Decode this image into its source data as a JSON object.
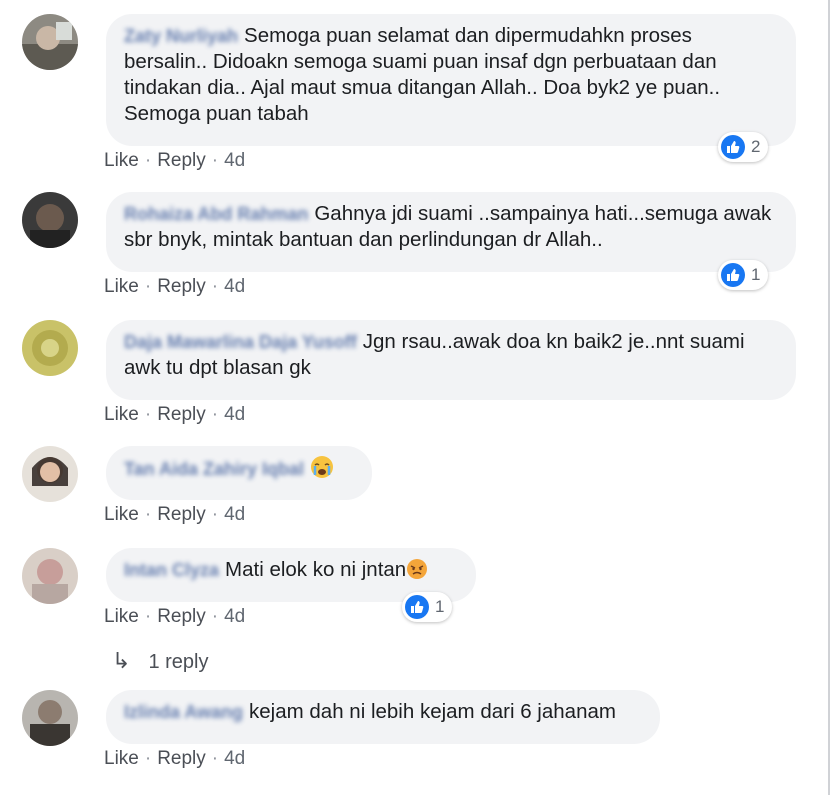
{
  "comments": [
    {
      "author": "Zaty Nurliyah",
      "text": "Semoga puan selamat dan dipermudahkn proses bersalin.. Didoakn semoga suami puan insaf dgn perbuataan dan tindakan dia.. Ajal maut smua ditangan Allah.. Doa byk2 ye puan.. Semoga puan tabah",
      "like": "Like",
      "reply": "Reply",
      "time": "4d",
      "reactions": "2"
    },
    {
      "author": "Rohaiza Abd Rahman",
      "text": "Gahnya jdi suami ..sampainya hati...semuga awak sbr bnyk, mintak bantuan dan perlindungan dr Allah..",
      "like": "Like",
      "reply": "Reply",
      "time": "4d",
      "reactions": "1"
    },
    {
      "author": "Daja Mawarlina Daja Yusoff",
      "text": "Jgn rsau..awak doa kn baik2 je..nnt suami awk tu dpt blasan gk",
      "like": "Like",
      "reply": "Reply",
      "time": "4d"
    },
    {
      "author": "Tan Aida Zahiry Iqbal",
      "text": "",
      "emoji": "crying-face",
      "like": "Like",
      "reply": "Reply",
      "time": "4d"
    },
    {
      "author": "Intan Clyza",
      "text": "Mati elok ko ni jntan",
      "emoji": "angry-face",
      "like": "Like",
      "reply": "Reply",
      "time": "4d",
      "reactions": "1",
      "replies_label": "1 reply"
    },
    {
      "author": "Izlinda Awang",
      "text": "kejam dah ni lebih kejam dari 6 jahanam",
      "like": "Like",
      "reply": "Reply",
      "time": "4d"
    }
  ],
  "colors": {
    "link": "#385898",
    "like_blue": "#1877f2",
    "bubble": "#f2f3f5",
    "meta": "#606770"
  },
  "icons": {
    "like": "thumbs-up-icon",
    "reply_arrow": "reply-arrow-icon"
  }
}
